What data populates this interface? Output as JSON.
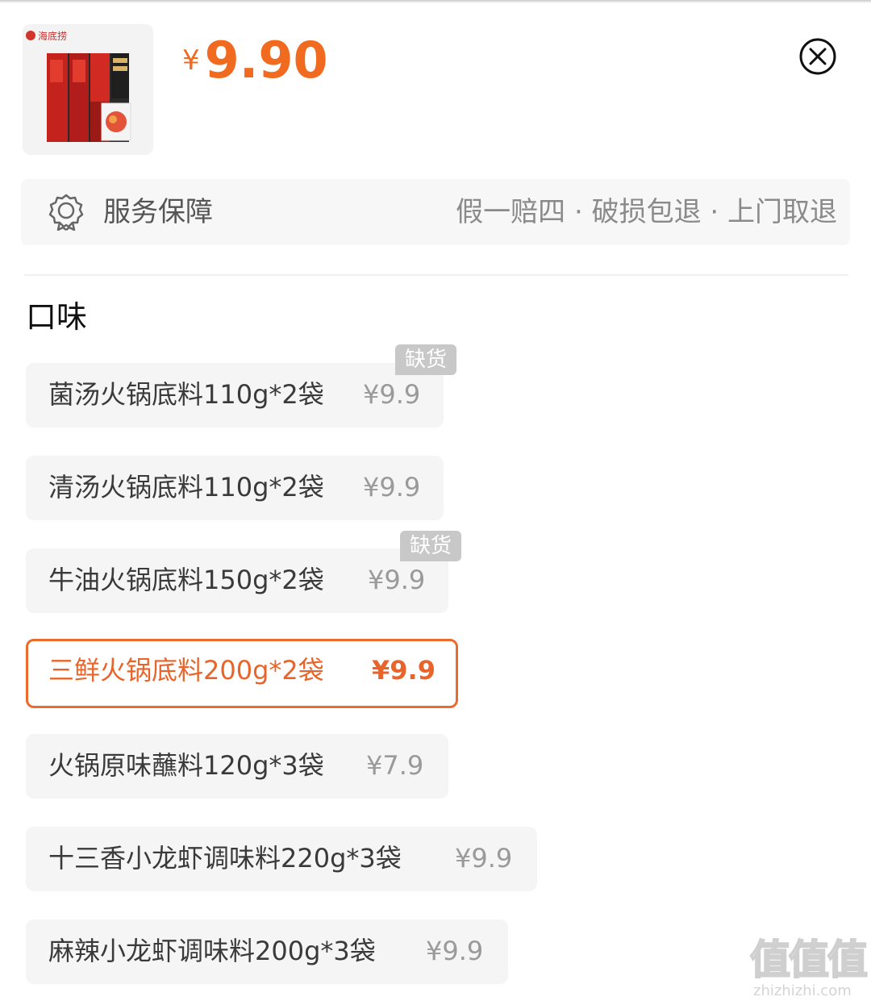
{
  "product": {
    "image_icon": "hotpot-seasoning-package-image",
    "brand_label": "海底捞",
    "price_symbol": "¥",
    "price_value": "9.90"
  },
  "service": {
    "icon": "rosette-badge-icon",
    "title": "服务保障",
    "detail": "假一赔四 · 破损包退 · 上门取退"
  },
  "section": {
    "title": "口味"
  },
  "options": [
    {
      "name": "菌汤火锅底料110g*2袋",
      "price": "¥9.9",
      "badge": "缺货",
      "selected": false
    },
    {
      "name": "清汤火锅底料110g*2袋",
      "price": "¥9.9",
      "badge": "",
      "selected": false
    },
    {
      "name": "牛油火锅底料150g*2袋",
      "price": "¥9.9",
      "badge": "缺货",
      "selected": false
    },
    {
      "name": "三鲜火锅底料200g*2袋",
      "price": "¥9.9",
      "badge": "",
      "selected": true
    },
    {
      "name": "火锅原味蘸料120g*3袋",
      "price": "¥7.9",
      "badge": "",
      "selected": false
    },
    {
      "name": "十三香小龙虾调味料220g*3袋",
      "price": "¥9.9",
      "badge": "",
      "selected": false
    },
    {
      "name": "麻辣小龙虾调味料200g*3袋",
      "price": "¥9.9",
      "badge": "",
      "selected": false
    }
  ],
  "watermark": {
    "logo": "值值值",
    "url": "zhizhizhi.com"
  },
  "colors": {
    "accent": "#f06a1f",
    "selected_border": "#ec6a2c",
    "chip_bg": "#f5f5f5",
    "badge_bg": "#c8c8c8"
  }
}
